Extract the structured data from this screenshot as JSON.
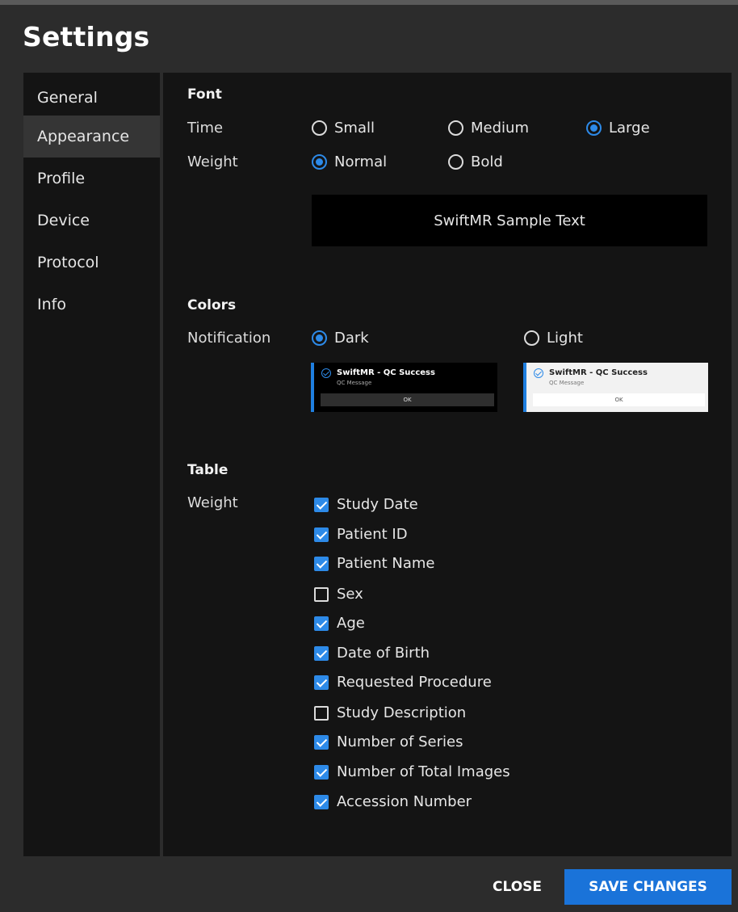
{
  "title": "Settings",
  "sidebar": {
    "items": [
      {
        "label": "General",
        "active": false
      },
      {
        "label": "Appearance",
        "active": true
      },
      {
        "label": "Profile",
        "active": false
      },
      {
        "label": "Device",
        "active": false
      },
      {
        "label": "Protocol",
        "active": false
      },
      {
        "label": "Info",
        "active": false
      }
    ]
  },
  "font": {
    "section_title": "Font",
    "time_label": "Time",
    "time_options": [
      "Small",
      "Medium",
      "Large"
    ],
    "time_selected": "Large",
    "weight_label": "Weight",
    "weight_options": [
      "Normal",
      "Bold"
    ],
    "weight_selected": "Normal",
    "sample_text": "SwiftMR Sample Text"
  },
  "colors": {
    "section_title": "Colors",
    "notification_label": "Notification",
    "options": [
      "Dark",
      "Light"
    ],
    "selected": "Dark",
    "preview": {
      "title": "SwiftMR - QC Success",
      "message": "QC Message",
      "ok": "OK"
    },
    "accent": "#2d8ae8"
  },
  "table": {
    "section_title": "Table",
    "weight_label": "Weight",
    "columns": [
      {
        "label": "Study Date",
        "checked": true
      },
      {
        "label": "Patient ID",
        "checked": true
      },
      {
        "label": "Patient Name",
        "checked": true
      },
      {
        "label": "Sex",
        "checked": false
      },
      {
        "label": "Age",
        "checked": true
      },
      {
        "label": "Date of Birth",
        "checked": true
      },
      {
        "label": "Requested Procedure",
        "checked": true
      },
      {
        "label": "Study Description",
        "checked": false
      },
      {
        "label": "Number of Series",
        "checked": true
      },
      {
        "label": "Number of Total Images",
        "checked": true
      },
      {
        "label": "Accession Number",
        "checked": true
      }
    ]
  },
  "footer": {
    "close_label": "CLOSE",
    "save_label": "SAVE CHANGES"
  }
}
